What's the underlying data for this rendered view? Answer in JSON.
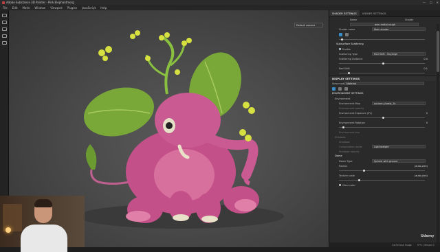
{
  "titlebar": {
    "title": "Adobe Substance 3D Painter - Pink Elephantmorg",
    "minimize": "—",
    "maximize": "□",
    "close": "✕"
  },
  "menu": [
    "File",
    "Edit",
    "Mode",
    "Window",
    "Viewport",
    "Plugins",
    "JavaScript",
    "Help"
  ],
  "viewport": {
    "camera_label": "Default camera"
  },
  "tabs": [
    "SHADER SETTINGS",
    "VIEWER SETTINGS"
  ],
  "shader": {
    "col1": "Name",
    "col2": "Shader",
    "name_value": "asm-metal-rough",
    "shader_name_label": "Shader name",
    "shader_name_value": "Main shader",
    "sss_header": "Subsurface Scattering",
    "enable_label": "Enable",
    "scattering_type_label": "Scattering Type",
    "scattering_type_value": "Red Shift - Rayleigh",
    "scattering_distance_label": "Scattering Distance",
    "scattering_distance_value": "0.5",
    "red_shift_label": "Red Shift",
    "red_shift_value": "0.1"
  },
  "display": {
    "header": "DISPLAY SETTINGS",
    "view_mode_label": "View mode",
    "view_mode_value": "Material",
    "env_header": "ENVIRONMENT SETTINGS",
    "environment_label": "Environment",
    "env_map_label": "Environment Map",
    "env_map_value": "autumn_forest_1k",
    "env_opacity_label": "Environment opacity",
    "env_exposure_label": "Environment Exposure (EV)",
    "env_exposure_value": "0",
    "env_rotation_label": "Environment Rotation",
    "env_rotation_value": "0",
    "env_blur_label": "Environment blur",
    "shadows_label": "Shadows",
    "shadow_enable_label": "Shadows",
    "computation_label": "Computation mode",
    "computation_value": "Light/weight",
    "shadow_opacity_label": "Shadows opacity",
    "dome_header": "Dome",
    "dome_type_label": "Dome Type",
    "dome_type_value": "Sphere with ground",
    "radius_label": "Radius",
    "radius_value": "(auto-pick)",
    "texture_scale_label": "Texture scale",
    "texture_scale_value": "(auto-pick)",
    "clear_color_label": "Clear color"
  },
  "status": {
    "cache": "Cache Disk Usage",
    "version": "97% | Version 0"
  },
  "watermark": "Udemy",
  "colors": {
    "accent": "#3a8ec8",
    "panel": "#2a2a2a",
    "viewport": "#4a4a4a"
  }
}
